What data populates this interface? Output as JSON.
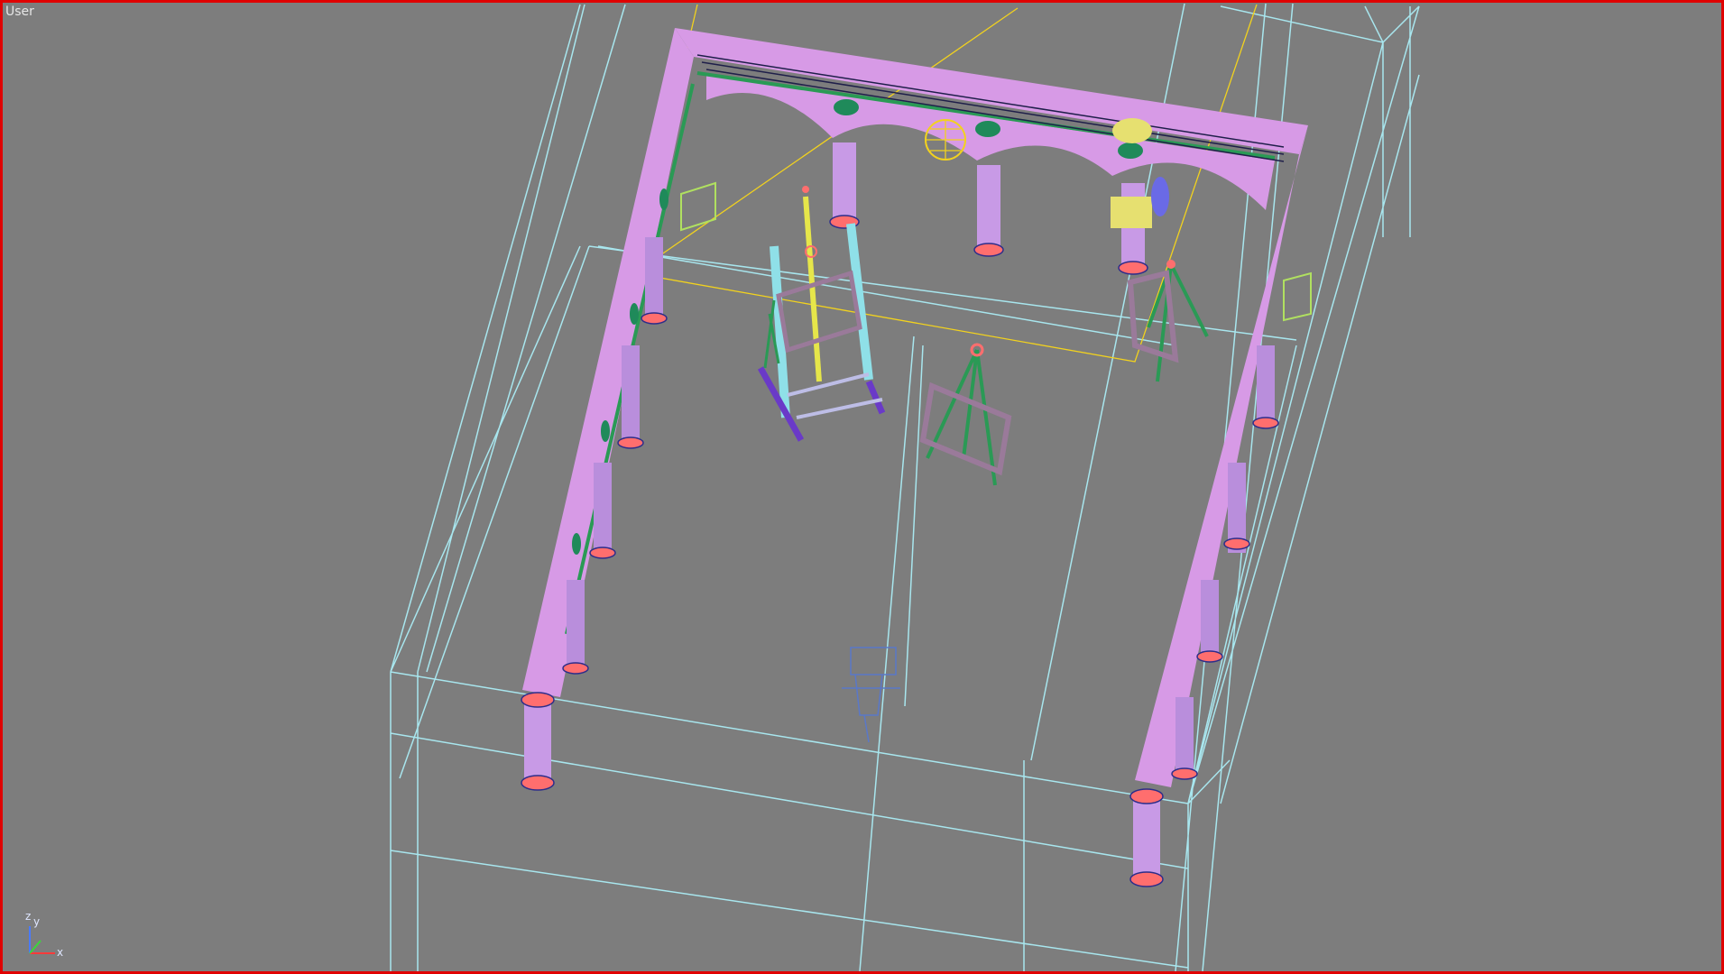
{
  "viewport": {
    "label": "User",
    "border_color": "#e00000",
    "background_color": "#7d7d7d",
    "active": true
  },
  "axis_gizmo": {
    "x_label": "x",
    "y_label": "y",
    "z_label": "z"
  },
  "colors": {
    "wireframe_box": "#a8e6ee",
    "colonnade": "#d79ae6",
    "column_base": "#ff6e6e",
    "trim": "#2a9a55",
    "light_helper": "#f2d21e",
    "easel_frame": "#9a7a9a",
    "camera_helper": "#5a78c8"
  }
}
